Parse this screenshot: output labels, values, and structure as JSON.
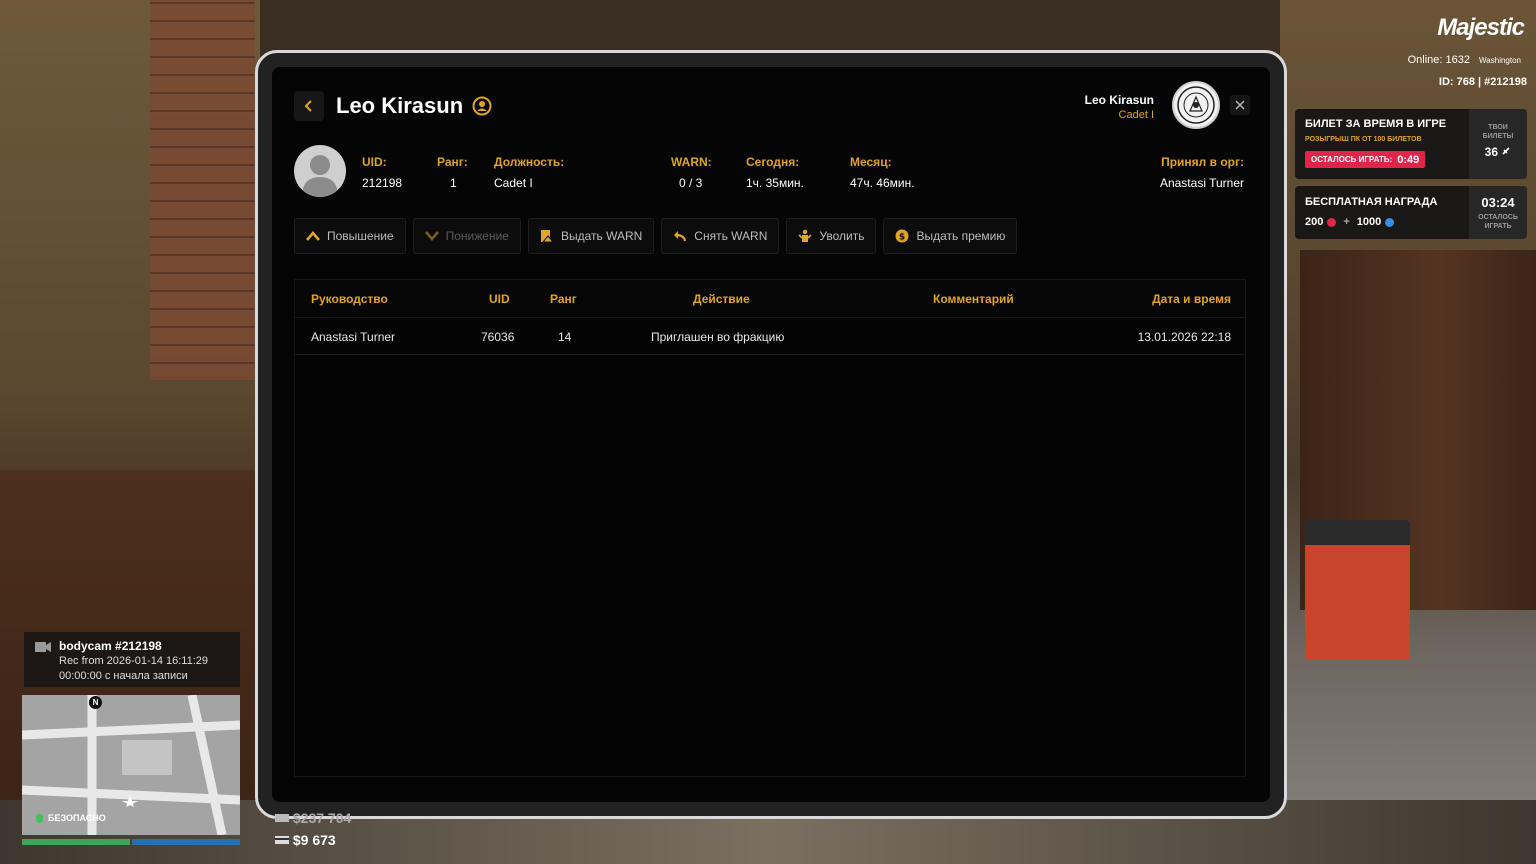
{
  "profile": {
    "name": "Leo Kirasun",
    "fields": [
      {
        "label": "UID:",
        "value": "212198"
      },
      {
        "label": "Ранг:",
        "value": "1"
      },
      {
        "label": "Должность:",
        "value": "Cadet I"
      },
      {
        "label": "WARN:",
        "value": "0 / 3"
      },
      {
        "label": "Сегодня:",
        "value": "1ч. 35мин."
      },
      {
        "label": "Месяц:",
        "value": "47ч. 46мин."
      },
      {
        "label": "Принял в орг:",
        "value": "Anastasi Turner"
      }
    ]
  },
  "header": {
    "user_name": "Leo Kirasun",
    "user_rank": "Cadet I"
  },
  "actions": [
    {
      "label": "Повышение",
      "icon": "chevron-up-icon",
      "enabled": true
    },
    {
      "label": "Понижение",
      "icon": "chevron-down-icon",
      "enabled": false
    },
    {
      "label": "Выдать WARN",
      "icon": "warn-doc-icon",
      "enabled": true
    },
    {
      "label": "Снять WARN",
      "icon": "undo-icon",
      "enabled": true
    },
    {
      "label": "Уволить",
      "icon": "fire-user-icon",
      "enabled": true
    },
    {
      "label": "Выдать премию",
      "icon": "coin-icon",
      "enabled": true
    }
  ],
  "table": {
    "headers": [
      "Руководство",
      "UID",
      "Ранг",
      "Действие",
      "Комментарий",
      "Дата и время"
    ],
    "rows": [
      [
        "Anastasi Turner",
        "76036",
        "14",
        "Приглашен во фракцию",
        "",
        "13.01.2026 22:18"
      ]
    ]
  },
  "hud": {
    "logo": "Majestic",
    "online_label": "Online:",
    "online_count": "1632",
    "server": "Washington",
    "id_line": "ID: 768 | #212198",
    "ticket_card": {
      "title": "БИЛЕТ ЗА ВРЕМЯ В ИГРЕ",
      "subtitle": "РОЗЫГРЫШ ПК ОТ 100 БИЛЕТОВ",
      "pill_label": "ОСТАЛОСЬ ИГРАТЬ:",
      "pill_time": "0:49",
      "side_label_1": "ТВОИ",
      "side_label_2": "БИЛЕТЫ",
      "side_value": "36"
    },
    "reward_card": {
      "title": "БЕСПЛАТНАЯ НАГРАДА",
      "amount_1": "200",
      "plus": "+",
      "amount_2": "1000",
      "time": "03:24",
      "side_label_1": "ОСТАЛОСЬ",
      "side_label_2": "ИГРАТЬ"
    },
    "bodycam": {
      "title": "bodycam #212198",
      "line1": "Rec from 2026-01-14 16:11:29",
      "line2": "00:00:00 с начала записи"
    },
    "compass": "N",
    "zone": "БЕЗОПАСНО",
    "cash": "$237 704",
    "bank": "$9 673",
    "health_fraction": 0.5,
    "armor_fraction": 0.5
  },
  "colors": {
    "accent": "#e0a526",
    "pill": "#e0254a",
    "screen_bg": "#050505"
  }
}
